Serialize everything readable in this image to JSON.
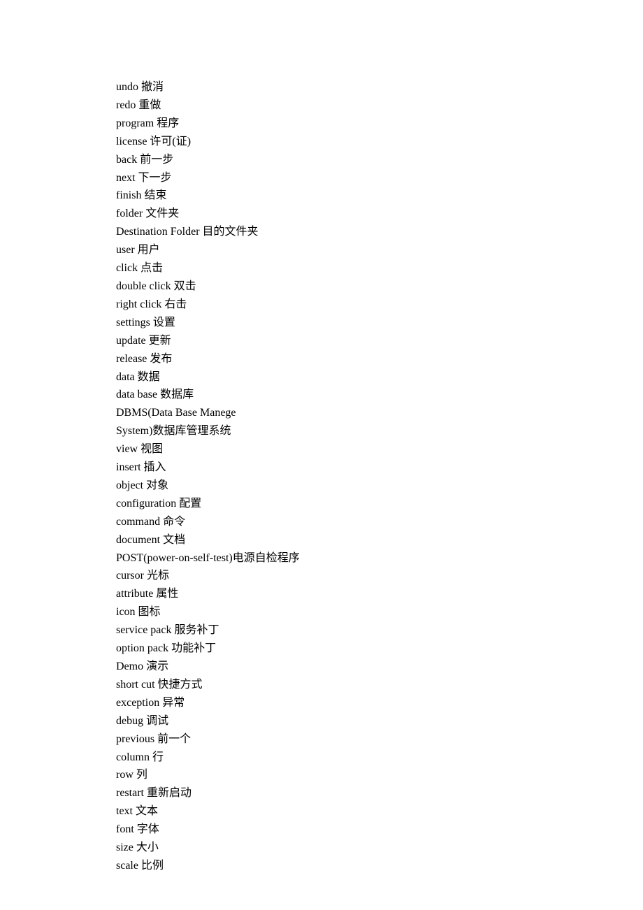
{
  "lines": [
    "undo 撤消",
    "redo 重做",
    "program 程序",
    "license 许可(证)",
    "back 前一步",
    "next 下一步",
    "finish 结束",
    "folder 文件夹",
    "Destination Folder 目的文件夹",
    "user 用户",
    "click 点击",
    "double click 双击",
    "right click 右击",
    "settings 设置",
    "update 更新",
    "release 发布",
    "data 数据",
    "data base 数据库",
    "DBMS(Data Base Manege",
    "System)数据库管理系统",
    "view 视图",
    "insert 插入",
    "object 对象",
    "configuration 配置",
    "command 命令",
    "document 文档",
    "POST(power-on-self-test)电源自检程序",
    "cursor 光标",
    "attribute 属性",
    "icon 图标",
    "service pack 服务补丁",
    "option pack 功能补丁",
    "Demo 演示",
    "short cut 快捷方式",
    "exception 异常",
    "debug 调试",
    "previous 前一个",
    "column 行",
    "row 列",
    "restart 重新启动",
    "text 文本",
    "font 字体",
    "size 大小",
    "scale 比例"
  ]
}
